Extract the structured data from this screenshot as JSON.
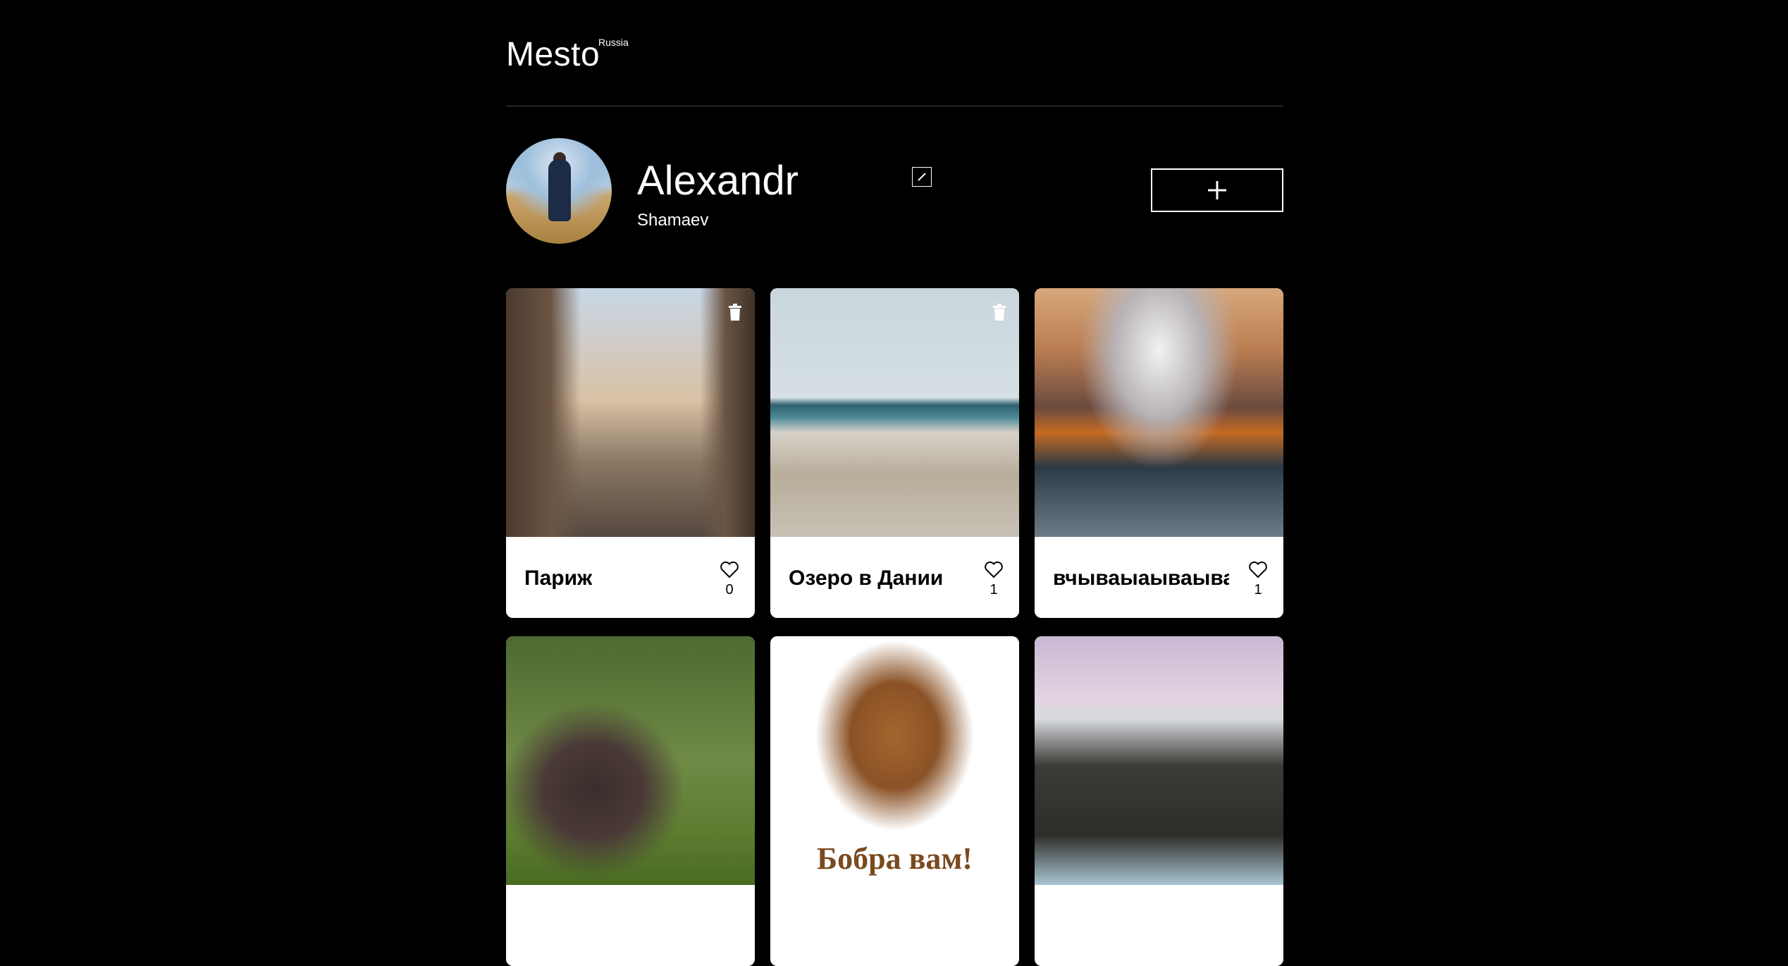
{
  "header": {
    "logo": "Mesto",
    "logo_sup": "Russia"
  },
  "profile": {
    "name": "Alexandr",
    "about": "Shamaev"
  },
  "cards": [
    {
      "title": "Париж",
      "likes": "0",
      "deletable": true
    },
    {
      "title": "Озеро в Дании",
      "likes": "1",
      "deletable": true
    },
    {
      "title": "вчываыаываыва",
      "likes": "1",
      "deletable": false
    },
    {
      "title": "",
      "likes": "",
      "deletable": false
    },
    {
      "title": "",
      "likes": "",
      "deletable": false,
      "image_text": "Бобра вам!"
    },
    {
      "title": "",
      "likes": "",
      "deletable": false
    }
  ],
  "icons": {
    "edit": "pencil-icon",
    "add": "plus-icon",
    "like": "heart-icon",
    "delete": "trash-icon"
  },
  "colors": {
    "background": "#000000",
    "card": "#ffffff",
    "text": "#ffffff"
  }
}
